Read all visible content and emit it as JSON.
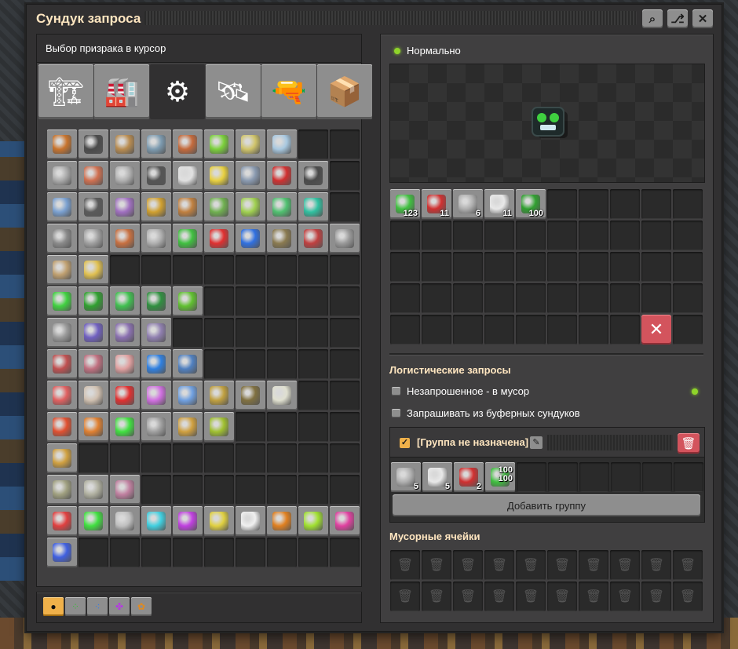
{
  "window": {
    "title": "Сундук запроса",
    "search_icon": "⌕",
    "tree_icon": "⎇",
    "close_icon": "✕"
  },
  "left": {
    "header": "Выбор призрака в курсор",
    "tabs": [
      {
        "name": "logistics",
        "icon": "🏗"
      },
      {
        "name": "production",
        "icon": "🏭"
      },
      {
        "name": "intermediate-products",
        "icon": "⚙"
      },
      {
        "name": "space",
        "icon": "🛰"
      },
      {
        "name": "combat",
        "icon": "🔫"
      },
      {
        "name": "unsorted",
        "icon": "📦"
      }
    ],
    "active_tab": 2,
    "rows": [
      [
        "#c8742d",
        "#4a4a4a",
        "#b98c50",
        "#7d9bb0",
        "#c46a3c",
        "#7bd03a",
        "#d0c46a",
        "#a8c8e0",
        "",
        ""
      ],
      [
        "#aaaaaa",
        "#d07050",
        "#b0b0b0",
        "#555555",
        "#e0e0e0",
        "#e8d040",
        "#8a9ab0",
        "#d03030",
        "#4a4a4a",
        ""
      ],
      [
        "#7aa0d0",
        "#5a5a5a",
        "#a070c0",
        "#d0a030",
        "#c08040",
        "#70b050",
        "#a0d050",
        "#50c070",
        "#30c0a0",
        ""
      ],
      [
        "#8a8a8a",
        "#a0a0a0",
        "#c87040",
        "#b0b0b0",
        "#40c040",
        "#e03030",
        "#3070e0",
        "#8a7a50",
        "#c04040",
        "#9a9a9a"
      ],
      [
        "#c0a070",
        "#e0c050",
        "",
        "",
        "",
        "",
        "",
        "",
        "",
        ""
      ],
      [
        "#40d040",
        "#30a030",
        "#40c050",
        "#309040",
        "#60c030",
        "",
        "",
        "",
        "",
        ""
      ],
      [
        "#9a9a9a",
        "#7060c0",
        "#8a70b0",
        "#9080b0",
        "",
        "",
        "",
        "",
        "",
        ""
      ],
      [
        "#c05050",
        "#c07080",
        "#e0a0a0",
        "#3080e0",
        "#5080c0",
        "",
        "",
        "",
        "",
        ""
      ],
      [
        "#e06060",
        "#d0c0b0",
        "#e03030",
        "#d070e0",
        "#70a0e0",
        "#c0a040",
        "#807040",
        "#e0e0d0",
        "",
        ""
      ],
      [
        "#e05030",
        "#e08030",
        "#40e040",
        "#a0a0a0",
        "#d0a040",
        "#a0c030",
        "",
        "",
        "",
        ""
      ],
      [
        "#d0a040",
        "",
        "",
        "",
        "",
        "",
        "",
        "",
        "",
        ""
      ],
      [
        "#a0a080",
        "#b0b0a0",
        "#c080a0",
        "",
        "",
        "",
        "",
        "",
        "",
        ""
      ],
      [
        "#e04040",
        "#40e040",
        "#c0c0c0",
        "#40d0e0",
        "#c040e0",
        "#e0d040",
        "#f0f0f0",
        "#e08020",
        "#a0e030",
        "#e040a0"
      ],
      [
        "#4060e0",
        "",
        "",
        "",
        "",
        "",
        "",
        "",
        "",
        ""
      ]
    ],
    "quality_tabs": [
      "●",
      "⁘",
      "⁖",
      "✤",
      "✿"
    ],
    "quality_colors": [
      "#111111",
      "#3fb93f",
      "#3d7de0",
      "#b43ce0",
      "#e08a20"
    ]
  },
  "right": {
    "status": "Нормально",
    "status_color": "#8fd42a",
    "inventory": [
      {
        "color": "#40c040",
        "count": "123"
      },
      {
        "color": "#d03030",
        "count": "11"
      },
      {
        "color": "#b0b0b0",
        "count": "6"
      },
      {
        "color": "#e8e8e8",
        "count": "11"
      },
      {
        "color": "#30a030",
        "count": "100"
      }
    ],
    "logistic_heading": "Логистические запросы",
    "option_trash": "Незапрошенное - в мусор",
    "option_buffer": "Запрашивать из буферных сундуков",
    "group_name": "[Группа не назначена]",
    "requests": [
      {
        "color": "#b0b0b0",
        "count": "5"
      },
      {
        "color": "#e8e8e8",
        "count": "5"
      },
      {
        "color": "#d03030",
        "count": "2"
      },
      {
        "color": "#40c040",
        "count_top": "100",
        "count_bottom": "100"
      }
    ],
    "add_group": "Добавить группу",
    "trash_heading": "Мусорные ячейки"
  }
}
